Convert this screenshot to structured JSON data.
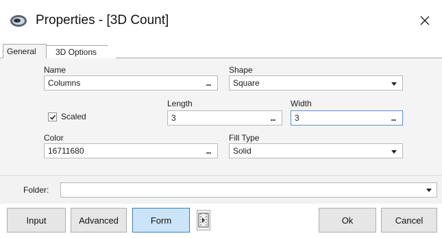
{
  "window": {
    "title": "Properties - [3D Count]"
  },
  "tabs": [
    {
      "label": "General",
      "active": true
    },
    {
      "label": "3D Options",
      "active": false
    }
  ],
  "fields": {
    "name": {
      "label": "Name",
      "value": "Columns"
    },
    "shape": {
      "label": "Shape",
      "value": "Square"
    },
    "scaled": {
      "label": "Scaled",
      "checked": true
    },
    "length": {
      "label": "Length",
      "value": "3"
    },
    "width": {
      "label": "Width",
      "value": "3"
    },
    "color": {
      "label": "Color",
      "value": "16711680"
    },
    "fill_type": {
      "label": "Fill Type",
      "value": "Solid"
    }
  },
  "folder": {
    "label": "Folder:",
    "value": ""
  },
  "buttons": {
    "input": "Input",
    "advanced": "Advanced",
    "form": "Form",
    "ok": "Ok",
    "cancel": "Cancel"
  },
  "ellipsis": "...",
  "icons": {
    "app": "app-logo-icon",
    "close": "close-icon",
    "dropdown": "chevron-down-icon",
    "check": "checkmark-icon",
    "play_frame": "play-frame-icon"
  }
}
